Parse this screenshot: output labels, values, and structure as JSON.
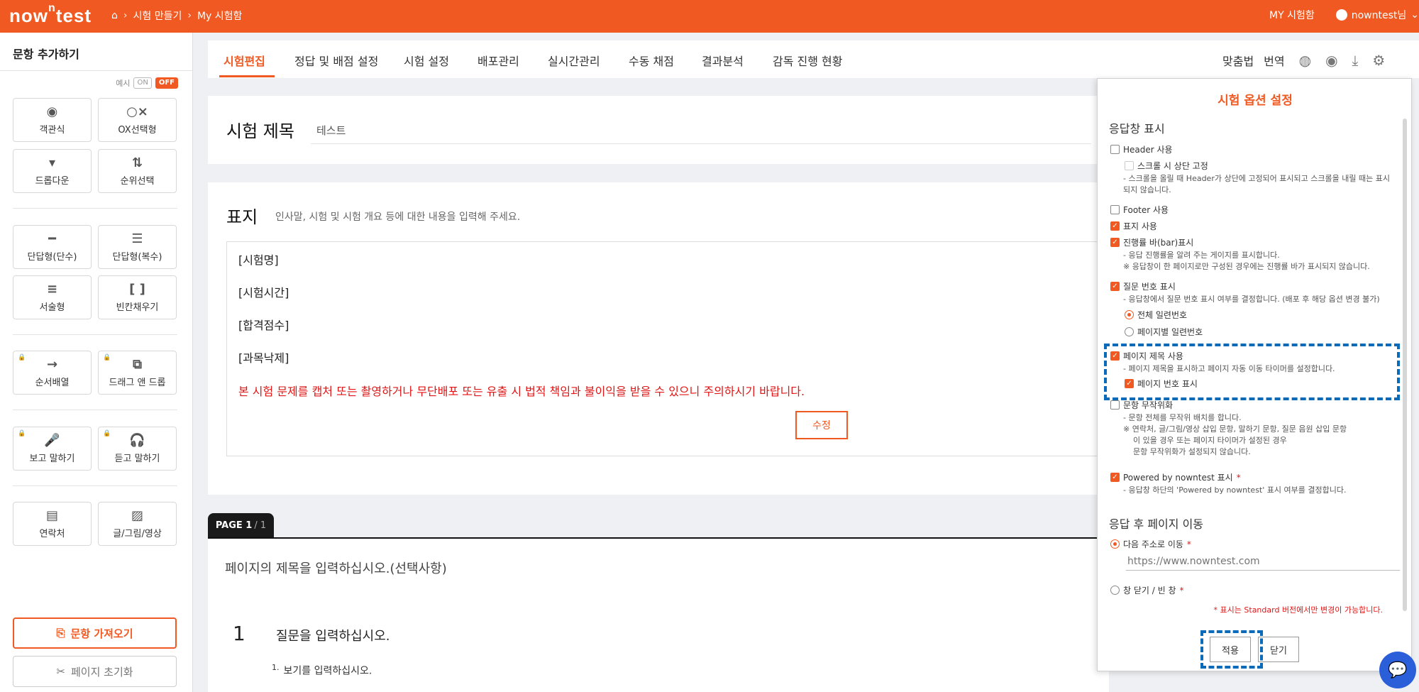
{
  "header": {
    "logo_main": "now",
    "logo_sup": "n",
    "logo_tail": "test",
    "breadcrumb": [
      "시험 만들기",
      "My 시험함"
    ],
    "my_exams": "MY 시험함",
    "user": "nowntest님"
  },
  "sidebar": {
    "title": "문항 추가하기",
    "example_label": "예시",
    "toggle_on": "ON",
    "toggle_off": "OFF",
    "items": [
      {
        "label": "객관식",
        "icon": "◉"
      },
      {
        "label": "OX선택형",
        "icon": "○×"
      },
      {
        "label": "드롭다운",
        "icon": "▾"
      },
      {
        "label": "순위선택",
        "icon": "⇅"
      },
      {
        "label": "단답형(단수)",
        "icon": "━"
      },
      {
        "label": "단답형(복수)",
        "icon": "☰"
      },
      {
        "label": "서술형",
        "icon": "≡"
      },
      {
        "label": "빈칸채우기",
        "icon": "[ ]"
      },
      {
        "label": "순서배열",
        "icon": "→"
      },
      {
        "label": "드래그 앤 드롭",
        "icon": "⧉"
      },
      {
        "label": "보고 말하기",
        "icon": "🎤"
      },
      {
        "label": "듣고 말하기",
        "icon": "🎧"
      },
      {
        "label": "연락처",
        "icon": "▤"
      },
      {
        "label": "글/그림/영상",
        "icon": "▨"
      }
    ],
    "import_label": "문항 가져오기",
    "reset_label": "페이지 초기화"
  },
  "tabs": {
    "items": [
      "시험편집",
      "정답 및 배점 설정",
      "시험 설정",
      "배포관리",
      "실시간관리",
      "수동 채점",
      "결과분석",
      "감독 진행 현황"
    ],
    "spell": "맞춤법",
    "translate": "번역"
  },
  "title_card": {
    "label": "시험 제목",
    "value": "테스트"
  },
  "cover": {
    "label": "표지",
    "hint": "인사말, 시험 및 시험 개요 등에 대한 내용을 입력해 주세요.",
    "lines": [
      "[시험명]",
      "[시험시간]",
      "[합격점수]",
      "[과목낙제]"
    ],
    "warning": "본 시험 문제를 캡처 또는 촬영하거나 무단배포 또는 유출 시 법적 책임과 불이익을 받을 수 있으니 주의하시기 바랍니다.",
    "edit": "수정"
  },
  "page": {
    "tab_label": "PAGE 1",
    "tab_total": "/ 1",
    "title_placeholder": "페이지의 제목을 입력하십시오.(선택사항)",
    "question_number": "1",
    "question_text": "질문을 입력하십시오.",
    "option_number": "1.",
    "option_text": "보기를 입력하십시오."
  },
  "panel": {
    "title": "시험 옵션 설정",
    "section_display": "응답창 표시",
    "header_use": "Header 사용",
    "header_fix": "스크롤 시 상단 고정",
    "header_fix_desc": "- 스크롤을 올릴 때 Header가 상단에 고정되어 표시되고 스크롤을 내릴 때는 표시되지 않습니다.",
    "footer_use": "Footer 사용",
    "cover_use": "표지 사용",
    "progress_bar": "진행률 바(bar)표시",
    "progress_desc1": "- 응답 진행률을 알려 주는 게이지를 표시합니다.",
    "progress_desc2": "※ 응답창이 한 페이지로만 구성된 경우에는 진행률 바가 표시되지 않습니다.",
    "qnum_show": "질문 번호 표시",
    "qnum_desc": "- 응답창에서 질문 번호 표시 여부를 결정합니다. (배포 후 해당 옵션 변경 불가)",
    "qnum_all": "전체 일련번호",
    "qnum_page": "페이지별 일련번호",
    "page_title_use": "페이지 제목 사용",
    "page_title_desc": "- 페이지 제목을 표시하고 페이지 자동 이동 타이머를 설정합니다.",
    "page_num_show": "페이지 번호 표시",
    "shuffle": "문항 무작위화",
    "shuffle_desc1": "- 문항 전체를 무작위 배치를 합니다.",
    "shuffle_desc2": "※ 연락처, 글/그림/영상 삽입 문항, 말하기 문항, 질문 음원 삽입 문항",
    "shuffle_desc3": "이 있을 경우 또는 페이지 타이머가 설정된 경우",
    "shuffle_desc4": "문항 무작위화가 설정되지 않습니다.",
    "powered": "Powered by nowntest 표시",
    "powered_desc": "- 응답창 하단의 'Powered by nowntest' 표시 여부를 결정합니다.",
    "section_after": "응답 후 페이지 이동",
    "goto_addr": "다음 주소로 이동",
    "addr_placeholder": "https://www.nowntest.com",
    "close_window": "창 닫기 / 빈 창",
    "req_star": "*",
    "note": "* 표시는 Standard 버전에서만 변경이 가능합니다.",
    "apply": "적용",
    "close": "닫기"
  },
  "colors": {
    "brand": "#f05a22",
    "highlight": "#0b6bb8",
    "warning": "#e01515"
  }
}
